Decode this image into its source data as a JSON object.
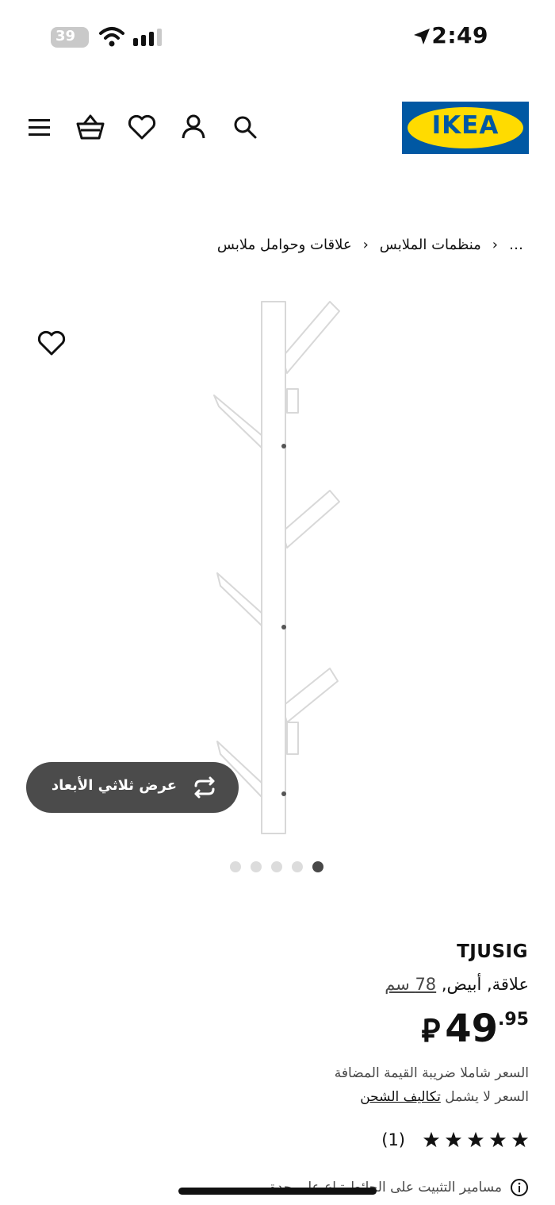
{
  "status_bar": {
    "time": "2:49",
    "battery": "39"
  },
  "header": {
    "logo_text": "IKEA"
  },
  "breadcrumb": {
    "ellipsis": "…",
    "items": [
      "منظمات الملابس",
      "علاقات وحوامل ملابس"
    ]
  },
  "gallery": {
    "view_3d_label": "عرض ثلاثي الأبعاد",
    "dots": 5,
    "active_dot": 5
  },
  "product": {
    "name": "TJUSIG",
    "description": "علاقة, أبيض,",
    "size": "78 سم",
    "price_currency": "⃁",
    "price_int": "49",
    "price_dec": ".95",
    "vat_note": "السعر شاملا ضريبة القيمة المضافة",
    "shipping_prefix": "السعر لا يشمل",
    "shipping_link": "تكاليف الشحن",
    "rating_count": "(1)",
    "rating_stars": 5,
    "fitting_note": "مسامير التثبيت على الحائط تباع على حدة"
  },
  "colors": {
    "ikea_blue": "#0058a3",
    "ikea_yellow": "#ffdb00",
    "pill_bg": "#4b4b4b"
  }
}
